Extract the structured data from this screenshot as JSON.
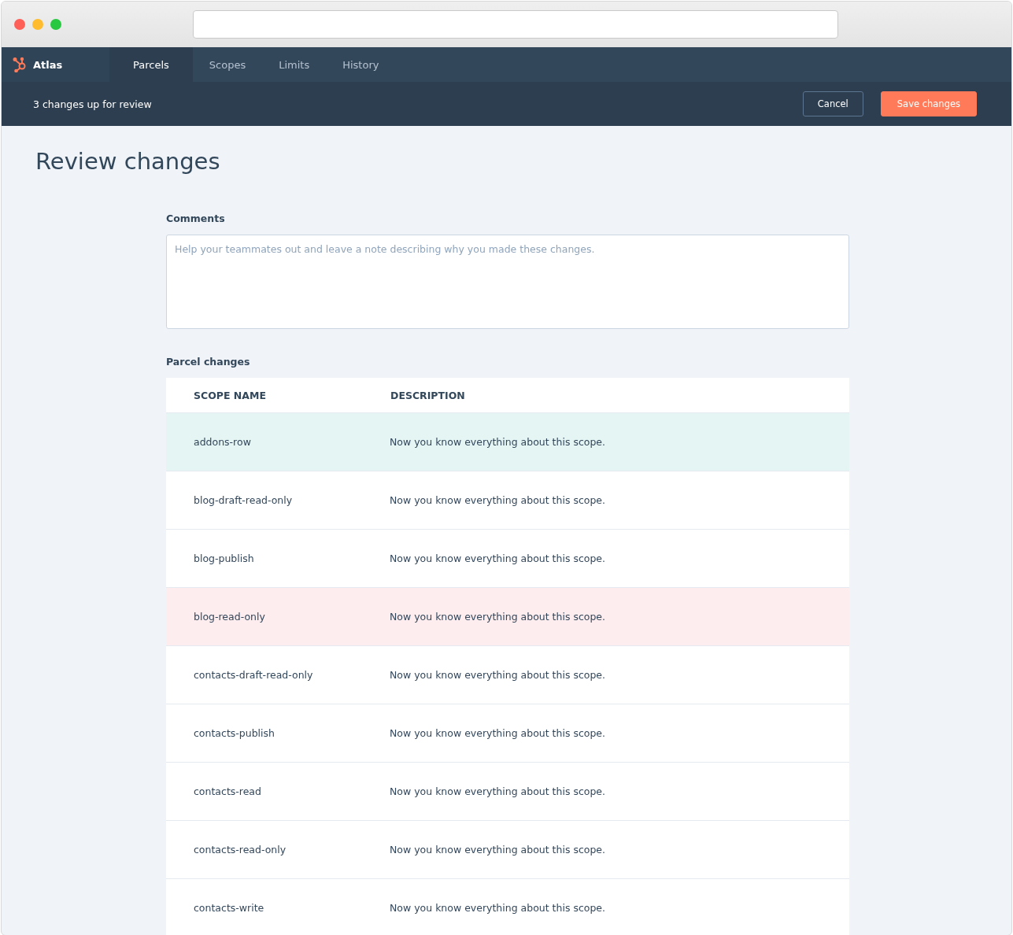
{
  "nav": {
    "brand": "Atlas",
    "tabs": [
      {
        "label": "Parcels",
        "selected": true
      },
      {
        "label": "Scopes",
        "selected": false
      },
      {
        "label": "Limits",
        "selected": false
      },
      {
        "label": "History",
        "selected": false
      }
    ]
  },
  "review_bar": {
    "message": "3 changes up for review",
    "buttons": [
      {
        "label": "Cancel",
        "kind": "secondary"
      },
      {
        "label": "Save changes",
        "kind": "primary"
      }
    ]
  },
  "page_title": "Review changes",
  "comments": {
    "label": "Comments",
    "placeholder": "Help your teammates out and leave a note describing why you made these changes."
  },
  "parcel_changes": {
    "label": "Parcel changes",
    "columns": [
      "SCOPE NAME",
      "DESCRIPTION"
    ],
    "rows": [
      {
        "name": "addons-row",
        "description": "Now you know everything about this scope.",
        "added": true,
        "removed": false
      },
      {
        "name": "blog-draft-read-only",
        "description": "Now you know everything about this scope.",
        "added": false,
        "removed": false
      },
      {
        "name": "blog-publish",
        "description": "Now you know everything about this scope.",
        "added": false,
        "removed": false
      },
      {
        "name": "blog-read-only",
        "description": "Now you know everything about this scope.",
        "added": false,
        "removed": true
      },
      {
        "name": "contacts-draft-read-only",
        "description": "Now you know everything about this scope.",
        "added": false,
        "removed": false
      },
      {
        "name": "contacts-publish",
        "description": "Now you know everything about this scope.",
        "added": false,
        "removed": false
      },
      {
        "name": "contacts-read",
        "description": "Now you know everything about this scope.",
        "added": false,
        "removed": false
      },
      {
        "name": "contacts-read-only",
        "description": "Now you know everything about this scope.",
        "added": false,
        "removed": false
      },
      {
        "name": "contacts-write",
        "description": "Now you know everything about this scope.",
        "added": false,
        "removed": false
      }
    ]
  }
}
